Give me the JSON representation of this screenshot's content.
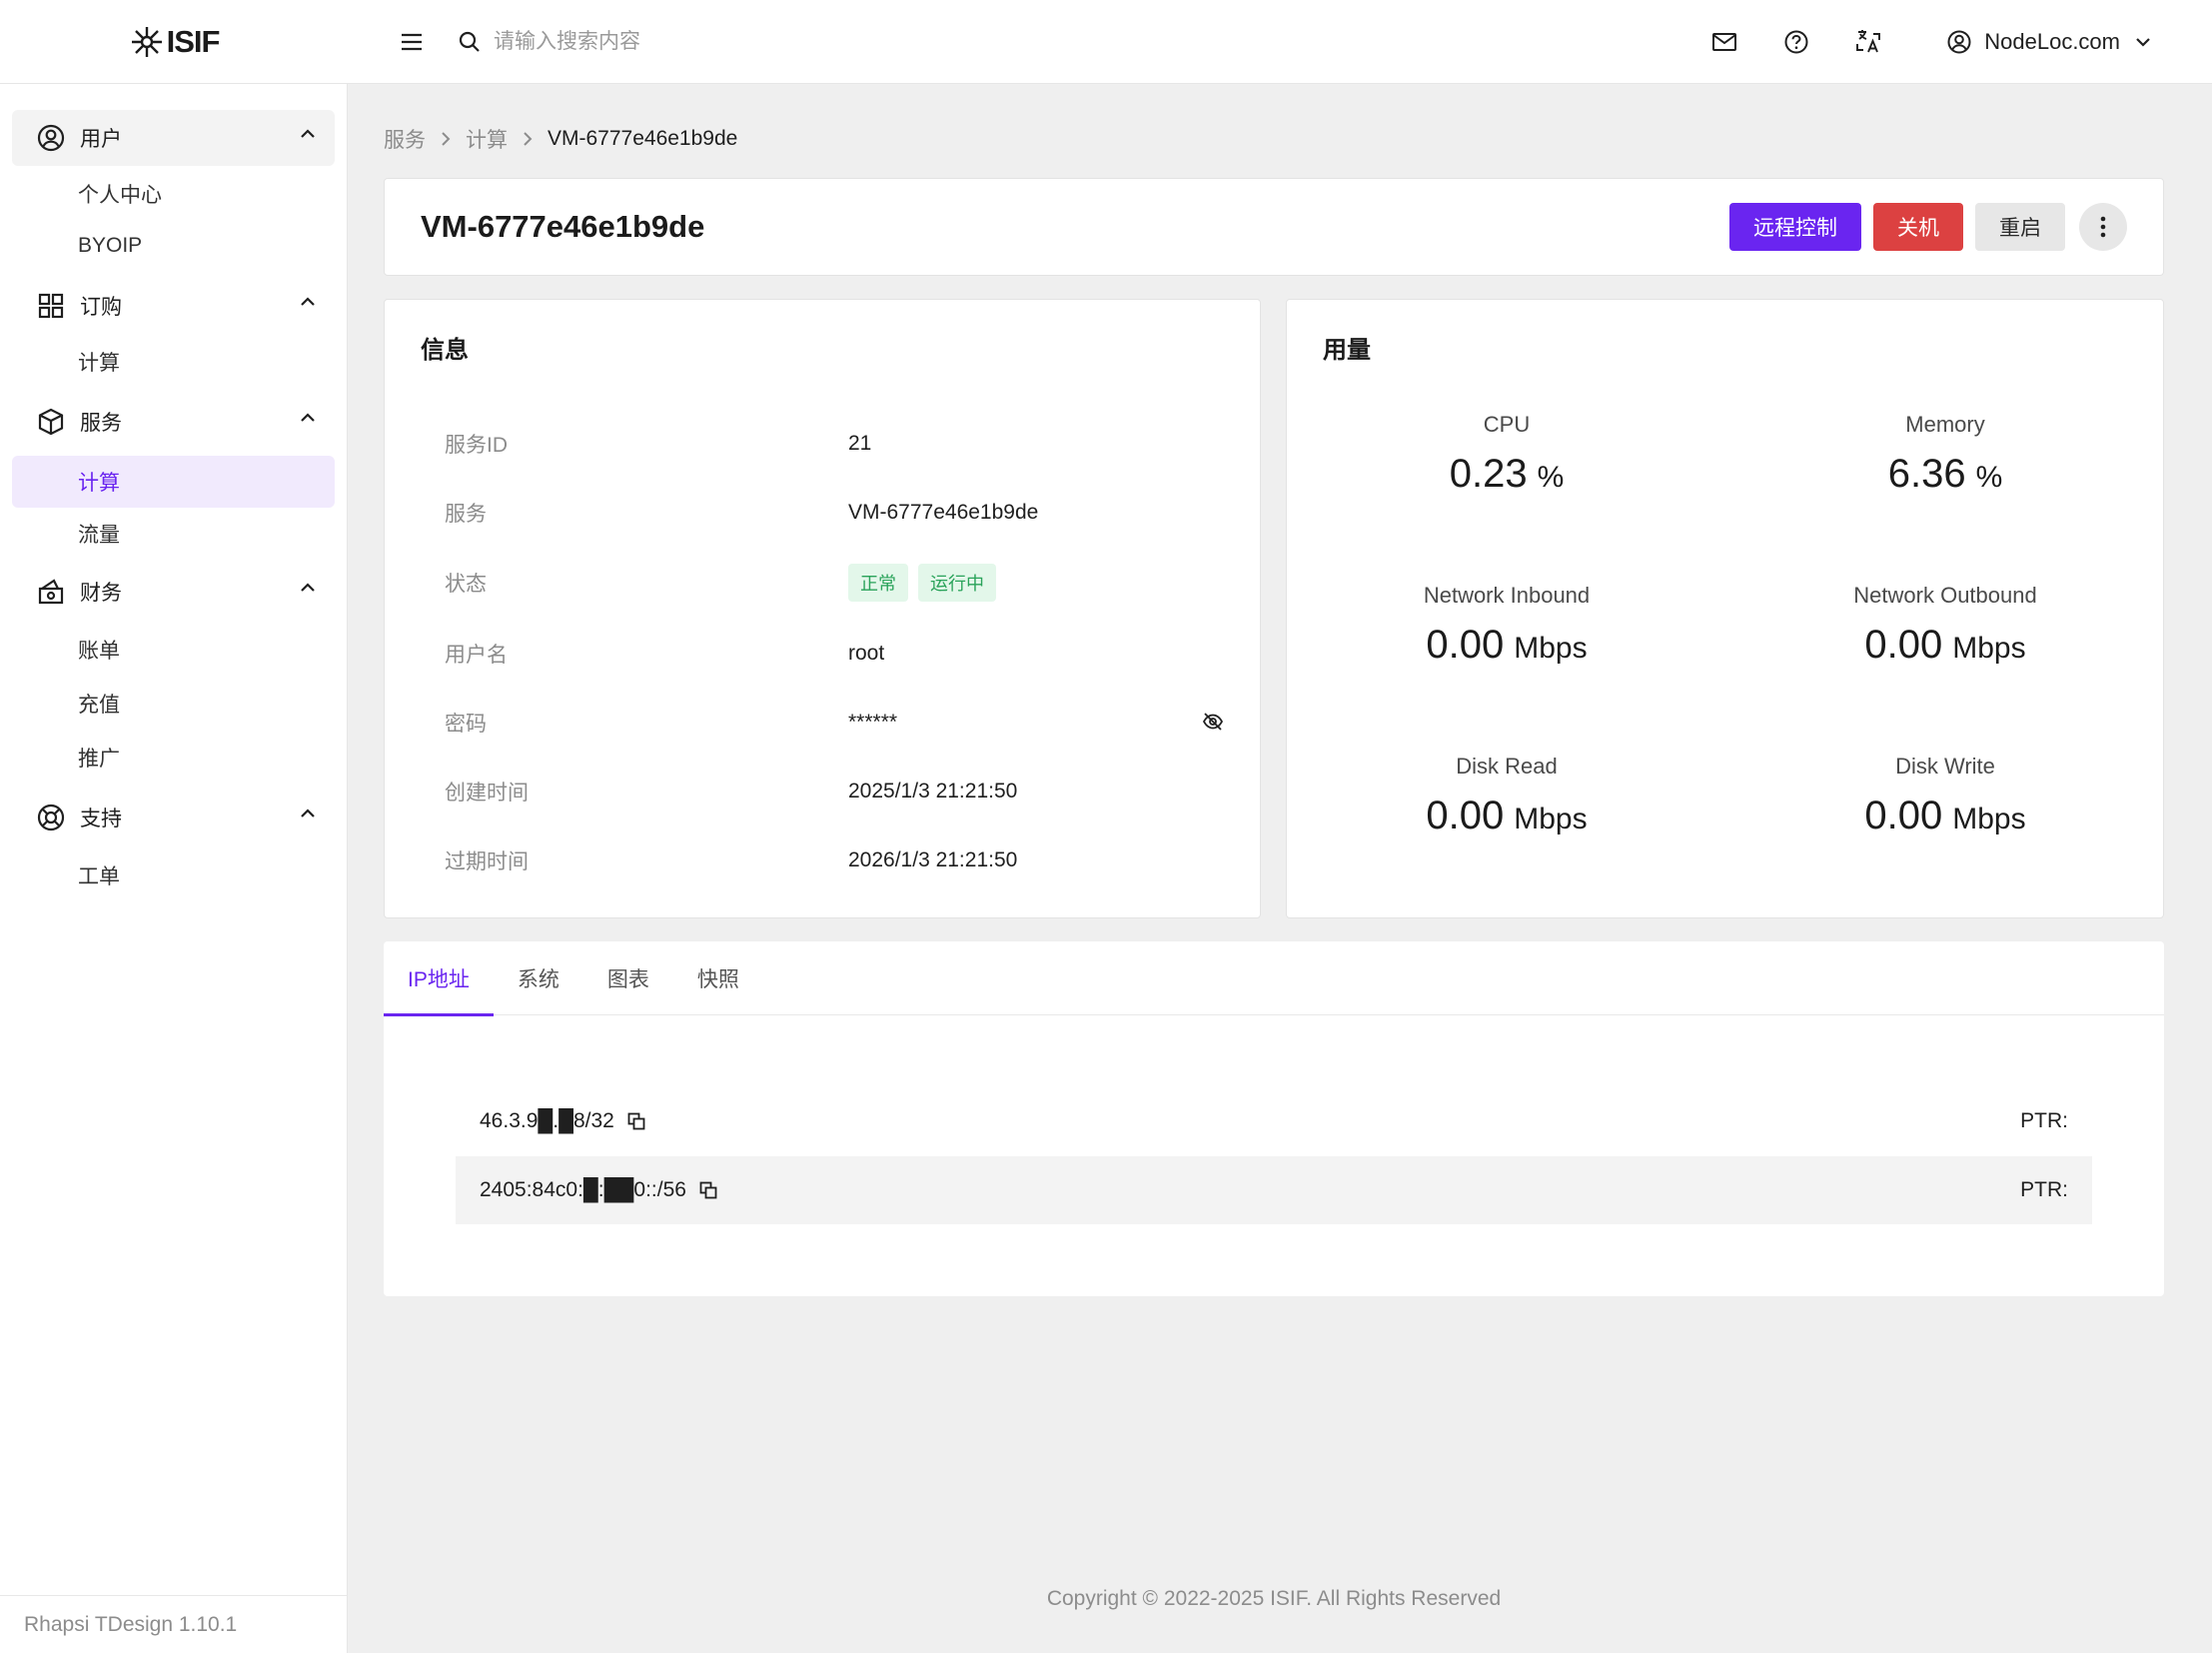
{
  "header": {
    "logo_text": "ISIF",
    "search_placeholder": "请输入搜索内容",
    "user_name": "NodeLoc.com",
    "icons": [
      "menu-icon",
      "search-icon",
      "mail-icon",
      "help-icon",
      "translate-icon",
      "user-circle-icon",
      "chevron-down-icon"
    ]
  },
  "sidebar": {
    "groups": [
      {
        "label": "用户",
        "icon": "user-circle-icon",
        "items": [
          "个人中心",
          "BYOIP"
        ]
      },
      {
        "label": "订购",
        "icon": "grid-icon",
        "items": [
          "计算"
        ]
      },
      {
        "label": "服务",
        "icon": "box-icon",
        "items": [
          "计算",
          "流量"
        ],
        "active_item": "计算"
      },
      {
        "label": "财务",
        "icon": "wallet-icon",
        "items": [
          "账单",
          "充值",
          "推广"
        ]
      },
      {
        "label": "支持",
        "icon": "lifebuoy-icon",
        "items": [
          "工单"
        ]
      }
    ],
    "footer": "Rhapsi TDesign 1.10.1"
  },
  "breadcrumb": [
    "服务",
    "计算",
    "VM-6777e46e1b9de"
  ],
  "page": {
    "title": "VM-6777e46e1b9de",
    "actions": {
      "remote": "远程控制",
      "shutdown": "关机",
      "restart": "重启"
    }
  },
  "info": {
    "title": "信息",
    "service_id": {
      "label": "服务ID",
      "value": "21"
    },
    "service": {
      "label": "服务",
      "value": "VM-6777e46e1b9de"
    },
    "status": {
      "label": "状态",
      "tags": [
        "正常",
        "运行中"
      ]
    },
    "username": {
      "label": "用户名",
      "value": "root"
    },
    "password": {
      "label": "密码",
      "value": "******"
    },
    "created": {
      "label": "创建时间",
      "value": "2025/1/3 21:21:50"
    },
    "expires": {
      "label": "过期时间",
      "value": "2026/1/3 21:21:50"
    }
  },
  "usage": {
    "title": "用量",
    "cpu": {
      "label": "CPU",
      "value": "0.23",
      "unit": "%"
    },
    "memory": {
      "label": "Memory",
      "value": "6.36",
      "unit": "%"
    },
    "net_in": {
      "label": "Network Inbound",
      "value": "0.00",
      "unit": "Mbps"
    },
    "net_out": {
      "label": "Network Outbound",
      "value": "0.00",
      "unit": "Mbps"
    },
    "disk_read": {
      "label": "Disk Read",
      "value": "0.00",
      "unit": "Mbps"
    },
    "disk_write": {
      "label": "Disk Write",
      "value": "0.00",
      "unit": "Mbps"
    }
  },
  "tabs": {
    "items": [
      "IP地址",
      "系统",
      "图表",
      "快照"
    ],
    "active": "IP地址"
  },
  "ips": [
    {
      "address": "46.3.9█.█8/32",
      "ptr": "PTR:"
    },
    {
      "address": "2405:84c0:█:██0::/56",
      "ptr": "PTR:"
    }
  ],
  "footer": {
    "copyright": "Copyright © 2022-2025 ISIF. All Rights Reserved"
  },
  "colors": {
    "accent": "#6a25f0",
    "danger": "#dc4141",
    "success": "#2aa35a"
  }
}
